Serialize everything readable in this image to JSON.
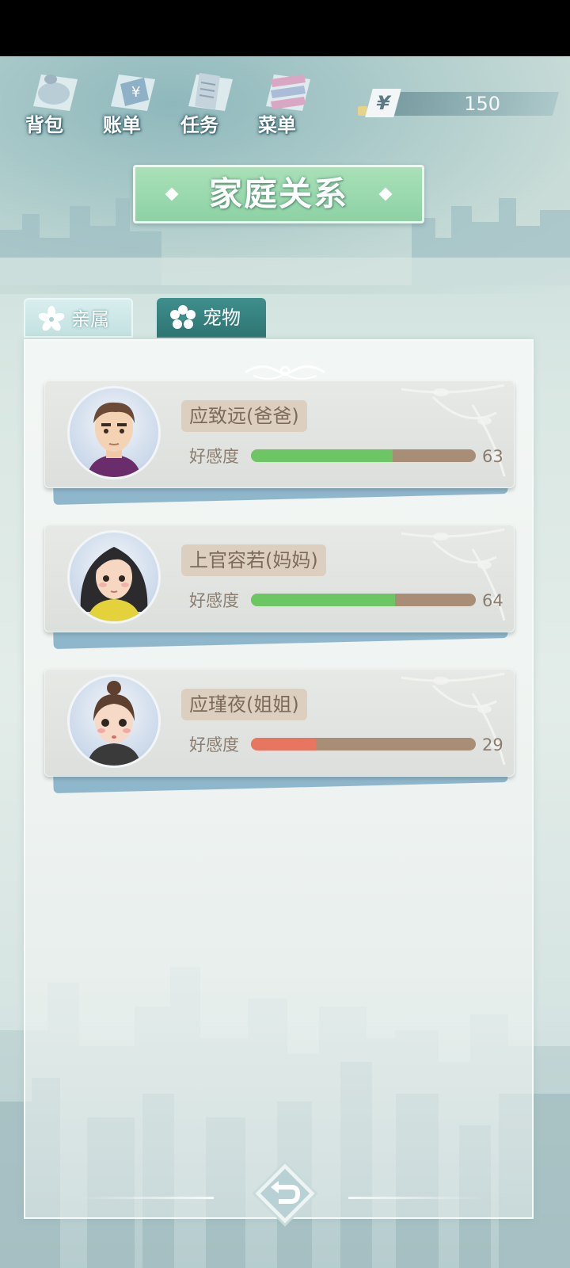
{
  "topnav": {
    "items": [
      {
        "label": "背包",
        "icon": "bag-icon"
      },
      {
        "label": "账单",
        "icon": "bill-icon"
      },
      {
        "label": "任务",
        "icon": "task-icon"
      },
      {
        "label": "菜单",
        "icon": "menu-icon"
      }
    ]
  },
  "currency": {
    "symbol": "¥",
    "amount": "150"
  },
  "title": "家庭关系",
  "tabs": [
    {
      "label": "亲属",
      "icon": "sakura-icon",
      "active": true
    },
    {
      "label": "宠物",
      "icon": "flower-icon",
      "active": false
    }
  ],
  "relatives": [
    {
      "name": "应致远(爸爸)",
      "affinity_label": "好感度",
      "affinity": "63",
      "affinity_fraction": 0.63,
      "bar_color": "#6cc663"
    },
    {
      "name": "上官容若(妈妈)",
      "affinity_label": "好感度",
      "affinity": "64",
      "affinity_fraction": 0.64,
      "bar_color": "#6cc663"
    },
    {
      "name": "应瑾夜(姐姐)",
      "affinity_label": "好感度",
      "affinity": "29",
      "affinity_fraction": 0.29,
      "bar_color": "#e8755f"
    }
  ],
  "footer": {
    "back_icon": "return-arrow-icon"
  }
}
